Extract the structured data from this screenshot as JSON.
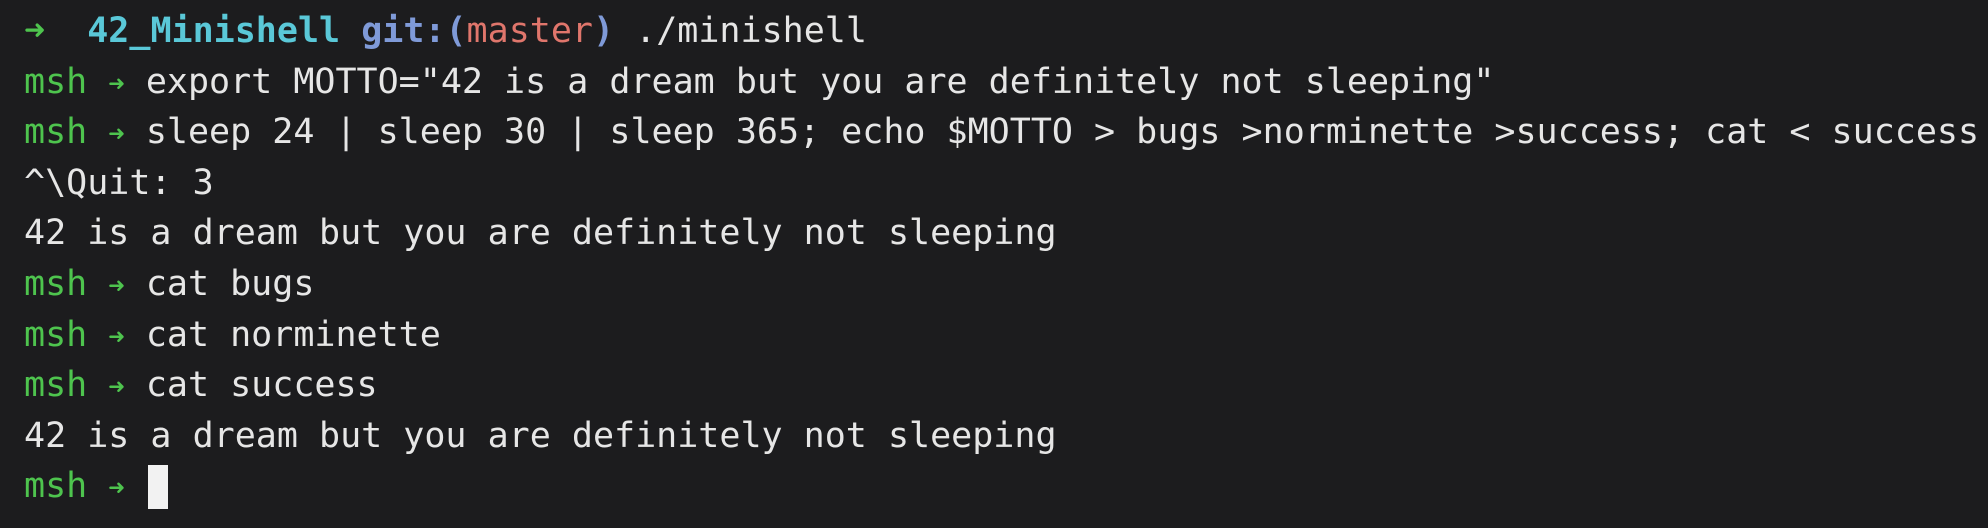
{
  "header": {
    "arrow": "➜",
    "dir": "42_Minishell",
    "git_label": "git:(",
    "branch": "master",
    "git_close": ")",
    "command": "./minishell"
  },
  "prompt": {
    "name": "msh",
    "arrow": "➜"
  },
  "lines": {
    "l1": "export MOTTO=\"42 is a dream but you are definitely not sleeping\"",
    "l2": "sleep 24 | sleep 30 | sleep 365; echo $MOTTO > bugs >norminette >success; cat < success",
    "l3": "^\\Quit: 3",
    "l4": "42 is a dream but you are definitely not sleeping",
    "l5": "cat bugs",
    "l6": "cat norminette",
    "l7": "cat success",
    "l8": "42 is a dream but you are definitely not sleeping"
  },
  "colors": {
    "background": "#1c1c1e",
    "text": "#e6e6e6",
    "prompt_green": "#4ec44e",
    "dir_cyan": "#5ac8d8",
    "git_blue": "#7f9ad8",
    "branch_red": "#e0766c"
  }
}
